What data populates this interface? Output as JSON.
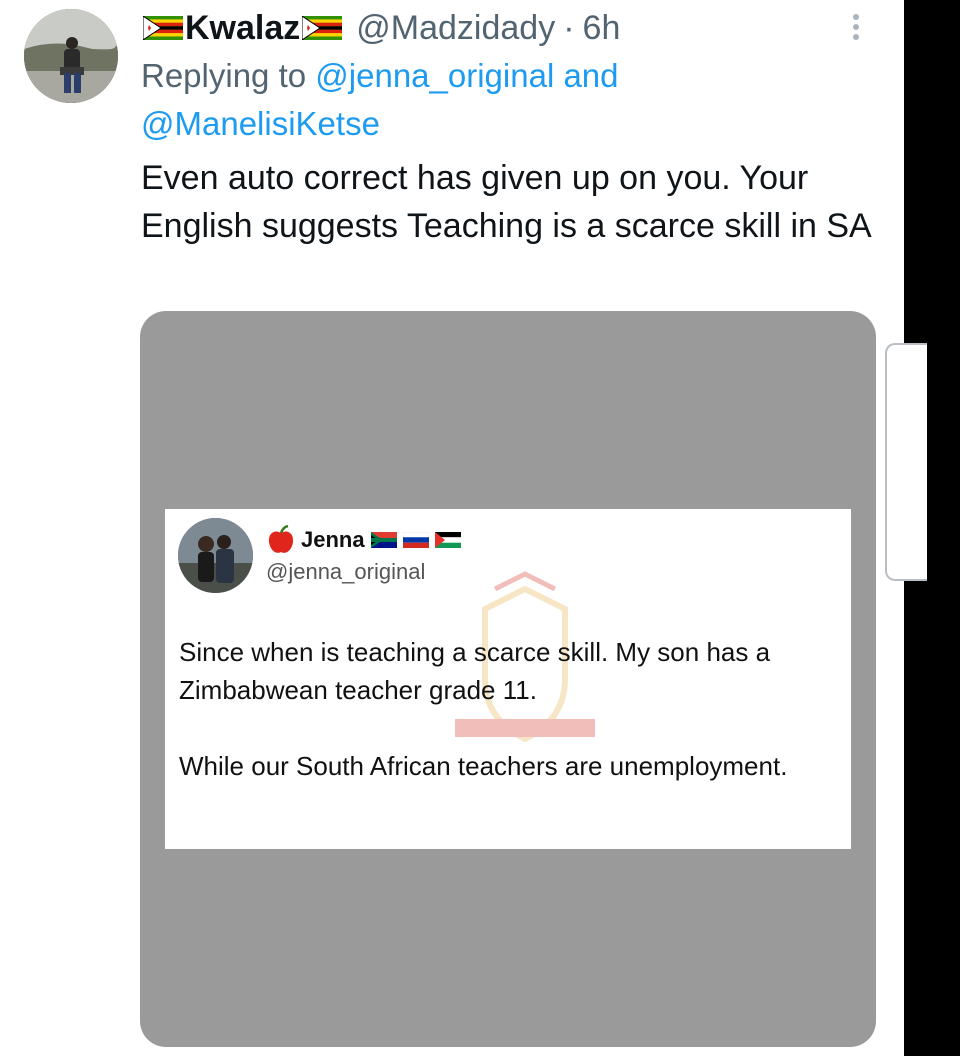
{
  "tweet": {
    "display_name": "Kwalaz",
    "handle": "@Madzidady",
    "separator": "·",
    "time": "6h",
    "replying_prefix": "Replying to",
    "replying_to": [
      "@jenna_original",
      "@ManelisiKetse"
    ],
    "replying_joiner": "and",
    "text": "Even auto correct has given up on you. Your English suggests Teaching is a scarce skill in SA",
    "name_flags": [
      "zimbabwe-flag",
      "zimbabwe-flag"
    ],
    "more_icon": "more-vertical-icon"
  },
  "quoted_post": {
    "name": "Jenna",
    "handle": "@jenna_original",
    "name_icon": "apple-icon",
    "flags": [
      "south-africa-flag",
      "russia-flag",
      "palestine-flag"
    ],
    "text_paragraphs": [
      "Since when is teaching a scarce skill.  My son has a Zimbabwean teacher grade 11.",
      "While our South African teachers are unemployment."
    ]
  },
  "colors": {
    "text": "#0f1419",
    "secondary": "#536471",
    "accent": "#1d9bf0",
    "media_bg": "#9a9a9b"
  }
}
